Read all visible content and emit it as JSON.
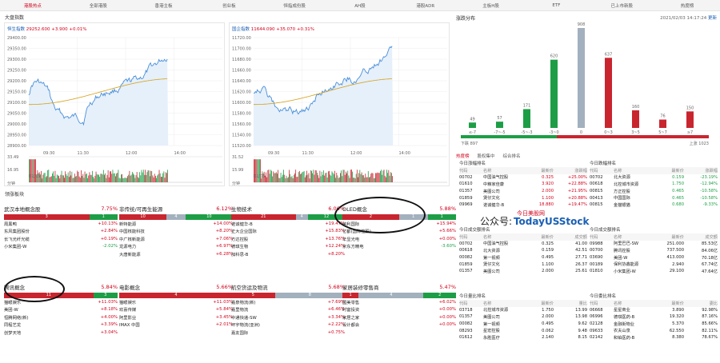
{
  "nav": {
    "tabs": [
      "港股热点",
      "全部港股",
      "香港主板",
      "创业板",
      "恒指成份股",
      "AH股",
      "港股ADR",
      "主板H股",
      "ETF",
      "已上市新股",
      "热度榜"
    ]
  },
  "index_panel_title": "大盘指数",
  "hsi": {
    "name": "恒生指数",
    "value": "29252.600",
    "change": "+3.900 +0.01%",
    "ylabels": [
      "29400.00",
      "29350.00",
      "29300.00",
      "29250.00",
      "29200.00",
      "29150.00",
      "29100.00",
      "29050.00",
      "29000.00",
      "28950.00",
      "28900.00"
    ],
    "vol_labels": [
      "33.49",
      "16.95"
    ],
    "xlabels": [
      "09:30",
      "11:30",
      "12:00",
      "14:00"
    ],
    "date": "02/03",
    "sep": "分钟"
  },
  "hscei": {
    "name": "国企指数",
    "value": "11644.090",
    "change": "+35.070 +0.31%",
    "ylabels": [
      "11720.00",
      "11700.00",
      "11680.00",
      "11660.00",
      "11640.00",
      "11620.00",
      "11600.00",
      "11580.00",
      "11560.00",
      "11540.00",
      "11520.00"
    ],
    "vol_labels": [
      "31.52",
      "15.99"
    ],
    "xlabels": [
      "09:30",
      "11:30",
      "12:00",
      "14:00"
    ],
    "date": "02/03",
    "sep": "分钟"
  },
  "dist": {
    "title": "涨跌分布",
    "timestamp": "2021/02/03 14:17:24",
    "refresh": "更新",
    "bars": [
      {
        "label": "≤-7",
        "value": "49",
        "n": 49,
        "color": "#1d9e46"
      },
      {
        "label": "-7~-5",
        "value": "57",
        "n": 57,
        "color": "#1d9e46"
      },
      {
        "label": "-5~-3",
        "value": "171",
        "n": 171,
        "color": "#1d9e46"
      },
      {
        "label": "-3~0",
        "value": "620",
        "n": 620,
        "color": "#1d9e46"
      },
      {
        "label": "0",
        "value": "908",
        "n": 908,
        "color": "#a3b0be"
      },
      {
        "label": "0~3",
        "value": "637",
        "n": 637,
        "color": "#c9252f"
      },
      {
        "label": "3~5",
        "value": "160",
        "n": 160,
        "color": "#c9252f"
      },
      {
        "label": "5~7",
        "value": "76",
        "n": 76,
        "color": "#c9252f"
      },
      {
        "label": "≥7",
        "value": "150",
        "n": 150,
        "color": "#c9252f"
      }
    ],
    "down": "下跌 897",
    "up": "上涨 1023"
  },
  "sector_title": "领涨板块",
  "sectors": [
    {
      "name": "武汉本地概念股",
      "pct": "7.75%",
      "bar": [
        "3",
        "",
        "1"
      ],
      "stocks": [
        [
          "周黑鸭",
          "+10.13%"
        ],
        [
          "东风集团股份",
          "+2.84%"
        ],
        [
          "长飞光纤光缆",
          "+0.19%"
        ],
        [
          "小米集团-W",
          "-2.02%"
        ]
      ]
    },
    {
      "name": "非传统/可再生能源",
      "pct": "6.12%",
      "bar": [
        "10",
        "4",
        "10"
      ],
      "stocks": [
        [
          "新特能源",
          "+14.00%"
        ],
        [
          "中国核能科技",
          "+8.20%"
        ],
        [
          "中广核新能源",
          "+7.06%"
        ],
        [
          "龙源电力",
          "+6.97%"
        ],
        [
          "大唐新能源",
          "+6.28%"
        ]
      ]
    },
    {
      "name": "生物技术",
      "pct": "6.06%",
      "bar": [
        "21",
        "4",
        "12"
      ],
      "stocks": [
        [
          "诺诚健华-B",
          "+19.47%"
        ],
        [
          "正大企业国际",
          "+15.83%"
        ],
        [
          "方达控股",
          "+13.76%"
        ],
        [
          "德琪生物",
          "+12.24%"
        ],
        [
          "加科思-B",
          "+8.20%"
        ]
      ]
    },
    {
      "name": "OLED概念",
      "pct": "5.88%",
      "bar": [
        "2",
        "1",
        "1"
      ],
      "stocks": [
        [
          "信利国际",
          "+15.94%"
        ],
        [
          "亿都(国际控股)",
          "+5.66%"
        ],
        [
          "华显光电",
          "+0.00%"
        ],
        [
          "京东方精电",
          "-3.60%"
        ]
      ]
    },
    {
      "name": "腾讯概念",
      "pct": "5.84%",
      "bar": [
        "11",
        "",
        "3"
      ],
      "stocks": [
        [
          "猫眼娱乐",
          "+11.03%"
        ],
        [
          "美团-W",
          "+8.18%"
        ],
        [
          "恒腾网络(新)",
          "+4.00%"
        ],
        [
          "同程艺龙",
          "+3.39%"
        ],
        [
          "创梦天地",
          "+3.04%"
        ]
      ]
    },
    {
      "name": "电影概念",
      "pct": "5.66%",
      "bar": [
        "4",
        "",
        ""
      ],
      "stocks": [
        [
          "猫眼娱乐",
          "+11.03%"
        ],
        [
          "欢喜传媒",
          "+5.84%"
        ],
        [
          "阿里影业",
          "+3.45%"
        ],
        [
          "IMAX 中国",
          "+2.01%"
        ]
      ]
    },
    {
      "name": "航空货运及物流",
      "pct": "5.68%",
      "bar": [
        "5",
        "8",
        ""
      ],
      "stocks": [
        [
          "嘉泉物流(新)",
          "+7.69%"
        ],
        [
          "嘉里物流",
          "+6.46%"
        ],
        [
          "中通快递-SW",
          "+3.34%"
        ],
        [
          "环宇物流(亚洲)",
          "+2.22%"
        ],
        [
          "嘉友国际",
          "+0.75%"
        ]
      ]
    },
    {
      "name": "家居装修零售商",
      "pct": "5.47%",
      "bar": [
        "1",
        "4",
        "2"
      ],
      "stocks": [
        [
          "国美零售",
          "+6.02%"
        ],
        [
          "时富投资",
          "+0.00%"
        ],
        [
          "家居之家",
          "+0.00%"
        ],
        [
          "设计都会",
          "+0.00%"
        ]
      ]
    }
  ],
  "subtabs": [
    "热度榜",
    "股权集中",
    "综合排名"
  ],
  "tables": [
    {
      "title": "今日涨幅排名",
      "headers": [
        "代码",
        "名称",
        "最新价",
        "涨跌幅"
      ],
      "rows": [
        [
          "00702",
          "中国油气控股",
          "0.325",
          "+25.00%"
        ],
        [
          "01610",
          "中粮家佳康",
          "3.920",
          "+22.88%"
        ],
        [
          "01357",
          "美图公司",
          "2.000",
          "+21.95%"
        ],
        [
          "01859",
          "煲仔文化",
          "1.100",
          "+20.88%"
        ],
        [
          "09969",
          "诺诚健华-B",
          "18.880",
          "+19.47%"
        ]
      ]
    },
    {
      "title": "今日跌幅排名",
      "headers": [
        "代码",
        "名称",
        "最新价",
        "涨跌幅"
      ],
      "rows": [
        [
          "00702",
          "北大资源",
          "0.159",
          "-23.19%"
        ],
        [
          "00618",
          "北控城市资源",
          "1.750",
          "-12.94%"
        ],
        [
          "00815",
          "方正控股",
          "0.465",
          "-10.58%"
        ],
        [
          "00413",
          "中国国际",
          "0.465",
          "-10.58%"
        ],
        [
          "00815",
          "金猫银猫",
          "0.680",
          "-9.33%"
        ]
      ]
    },
    {
      "title": "今日成交额排名",
      "headers": [
        "代码",
        "名称",
        "最新价",
        "成交额"
      ],
      "rows": [
        [
          "00702",
          "中国油气控股",
          "0.325",
          "41.00"
        ],
        [
          "00618",
          "北大资源",
          "0.159",
          "42.51"
        ],
        [
          "00082",
          "第一视频",
          "0.495",
          "27.71"
        ],
        [
          "01859",
          "煲仔文化",
          "1.100",
          "26.37"
        ],
        [
          "01357",
          "美图公司",
          "2.000",
          "25.61"
        ]
      ]
    },
    {
      "title": "今日成交额排名",
      "headers": [
        "代码",
        "名称",
        "最新价",
        "成交额"
      ],
      "rows": [
        [
          "09988",
          "阿里巴巴-SW",
          "251.000",
          "85.53亿"
        ],
        [
          "00700",
          "腾讯控股",
          "737.500",
          "84.06亿"
        ],
        [
          "03690",
          "美团-W",
          "413.000",
          "70.18亿"
        ],
        [
          "00189",
          "保利协鑫能源",
          "2.940",
          "67.74亿"
        ],
        [
          "01810",
          "小米集团-W",
          "29.100",
          "47.64亿"
        ]
      ]
    },
    {
      "title": "今日量比排名",
      "headers": [
        "代码",
        "名称",
        "最新价",
        "量比"
      ],
      "rows": [
        [
          "03718",
          "北控城市资源",
          "1.750",
          "13.99"
        ],
        [
          "01357",
          "美图公司",
          "2.000",
          "13.98"
        ],
        [
          "00082",
          "第一视频",
          "0.495",
          "9.62"
        ],
        [
          "08293",
          "星宏控股",
          "0.062",
          "9.48"
        ],
        [
          "01612",
          "永胜医疗",
          "2.140",
          "8.15"
        ]
      ]
    },
    {
      "title": "今日委比排名",
      "headers": [
        "代码",
        "名称",
        "最新价",
        "委比"
      ],
      "rows": [
        [
          "06668",
          "星星商业",
          "3.890",
          "92.98%"
        ],
        [
          "06996",
          "德琪医药-B",
          "19.320",
          "87.16%"
        ],
        [
          "02128",
          "金融街物业",
          "5.370",
          "85.66%"
        ],
        [
          "09633",
          "农夫山泉",
          "62.550",
          "82.11%"
        ],
        [
          "02142",
          "和铂医药-B",
          "8.380",
          "78.67%"
        ]
      ]
    }
  ],
  "watermark": {
    "line1": "公众号:",
    "brand": "TodayUSStock",
    "sub": "今日美股网"
  }
}
